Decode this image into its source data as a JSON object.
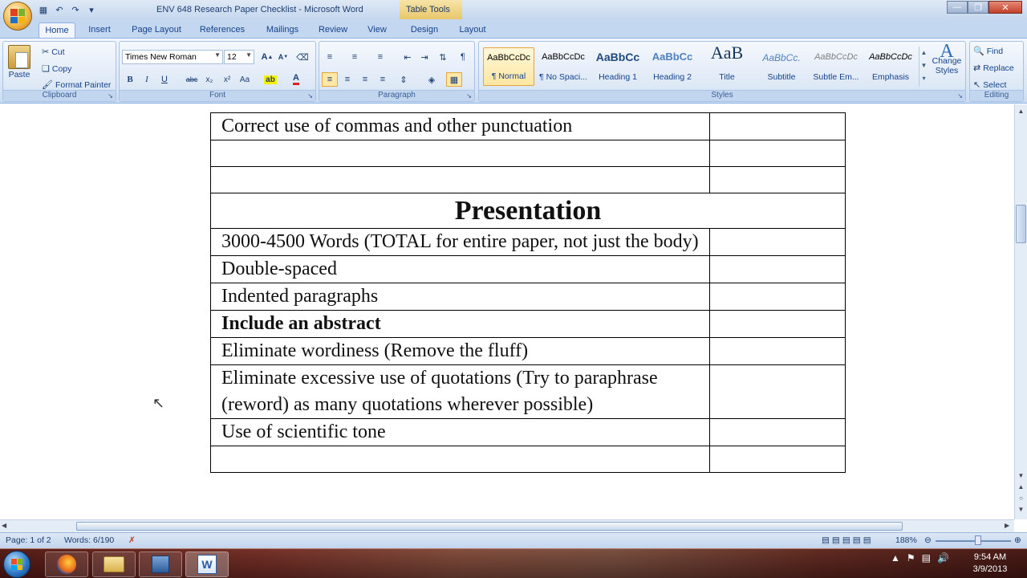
{
  "window": {
    "title": "ENV 648 Research Paper Checklist - Microsoft Word",
    "context_tab_title": "Table Tools"
  },
  "quick_access": {
    "icons": [
      "save-icon",
      "undo-icon",
      "redo-icon",
      "customize-icon"
    ]
  },
  "tabs": [
    "Home",
    "Insert",
    "Page Layout",
    "References",
    "Mailings",
    "Review",
    "View",
    "Design",
    "Layout"
  ],
  "ribbon": {
    "clipboard": {
      "label": "Clipboard",
      "paste": "Paste",
      "cut": "Cut",
      "copy": "Copy",
      "format_painter": "Format Painter"
    },
    "font": {
      "label": "Font",
      "font_name": "Times New Roman",
      "font_size": "12",
      "bold": "B",
      "italic": "I",
      "underline": "U",
      "strike": "abc",
      "subscript": "x₂",
      "superscript": "x²",
      "change_case": "Aa",
      "grow": "A",
      "shrink": "A",
      "font_color": "#e02020",
      "highlight_color": "#f8f000"
    },
    "paragraph": {
      "label": "Paragraph"
    },
    "styles": {
      "label": "Styles",
      "items": [
        {
          "preview": "AaBbCcDc",
          "name": "¶ Normal"
        },
        {
          "preview": "AaBbCcDc",
          "name": "¶ No Spaci..."
        },
        {
          "preview": "AaBbCc",
          "name": "Heading 1"
        },
        {
          "preview": "AaBbCc",
          "name": "Heading 2"
        },
        {
          "preview": "AaB",
          "name": "Title"
        },
        {
          "preview": "AaBbCc.",
          "name": "Subtitle"
        },
        {
          "preview": "AaBbCcDc",
          "name": "Subtle Em..."
        },
        {
          "preview": "AaBbCcDc",
          "name": "Emphasis"
        }
      ],
      "change_styles": "Change Styles"
    },
    "editing": {
      "label": "Editing",
      "find": "Find",
      "replace": "Replace",
      "select": "Select"
    }
  },
  "document": {
    "rows": [
      {
        "type": "item",
        "text": "Correct use of commas and other punctuation"
      },
      {
        "type": "empty"
      },
      {
        "type": "empty"
      },
      {
        "type": "header",
        "text": "Presentation"
      },
      {
        "type": "item",
        "text": "3000-4500 Words (TOTAL for entire paper, not just the body)"
      },
      {
        "type": "item",
        "text": " Double-spaced"
      },
      {
        "type": "item",
        "text": "Indented paragraphs"
      },
      {
        "type": "item",
        "bold": true,
        "text": "Include an abstract"
      },
      {
        "type": "item",
        "text": "Eliminate wordiness (Remove the fluff)"
      },
      {
        "type": "item",
        "text": "Eliminate excessive use of quotations (Try to paraphrase (reword) as many quotations wherever possible)"
      },
      {
        "type": "item",
        "text": "Use of scientific tone"
      },
      {
        "type": "empty"
      }
    ]
  },
  "statusbar": {
    "page": "Page: 1 of 2",
    "words": "Words: 6/190",
    "zoom": "188%"
  },
  "taskbar": {
    "apps": [
      "firefox-icon",
      "folder-icon",
      "save-disk-icon",
      "word-icon"
    ],
    "time": "9:54 AM",
    "date": "3/9/2013"
  }
}
